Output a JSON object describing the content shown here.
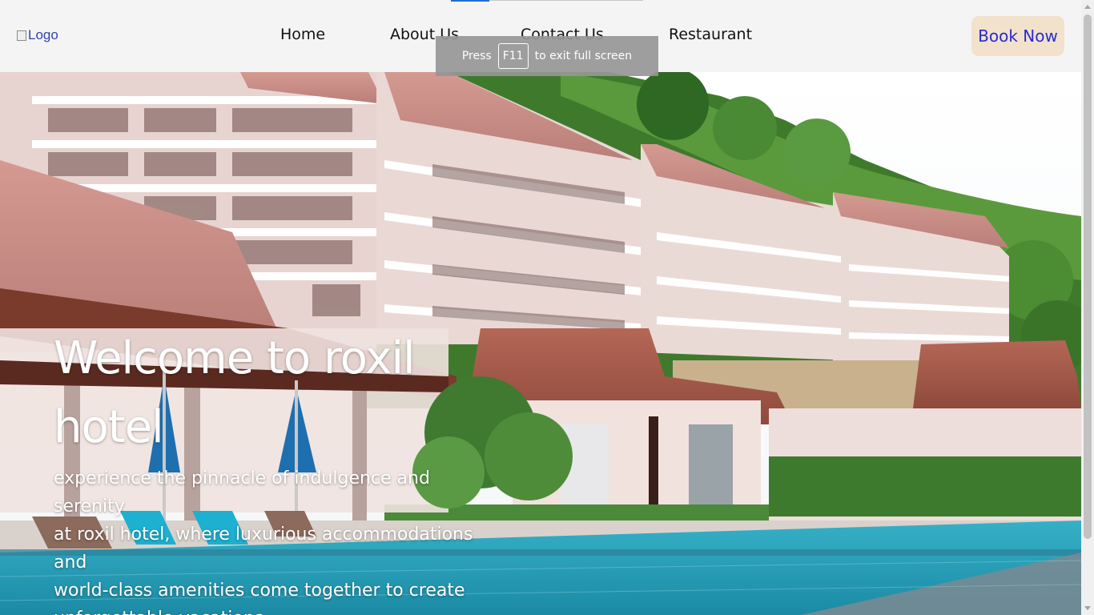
{
  "header": {
    "logo_alt": "Logo",
    "nav": [
      {
        "label": "Home"
      },
      {
        "label": "About Us"
      },
      {
        "label": "Contact Us"
      },
      {
        "label": "Restaurant"
      }
    ],
    "book_button": "Book Now"
  },
  "fullscreen_notice": {
    "press": "Press",
    "key": "F11",
    "suffix": "to exit full screen"
  },
  "hero": {
    "title_line1": "Welcome to roxil",
    "title_line2": "hotel",
    "subtitle_lines": [
      "experience the pinnacle of indulgence and",
      "serenity",
      "at roxil hotel, where luxurious accommodations",
      "and",
      "world-class amenities come together to create",
      "unforgettable vacations"
    ]
  },
  "colors": {
    "header_bg": "#f4f4f4",
    "book_bg": "#f2e2cc",
    "book_text": "#2a2ad0",
    "link_color": "#3344aa"
  }
}
